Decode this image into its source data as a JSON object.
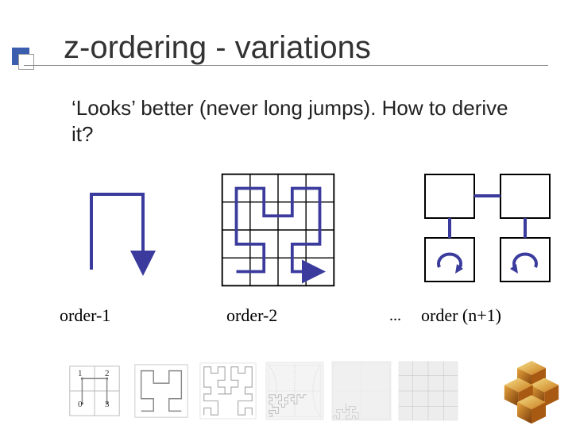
{
  "title": "z-ordering - variations",
  "body": "‘Looks’ better (never long jumps). How to derive it?",
  "figures": {
    "order1_label": "order-1",
    "order2_label": "order-2",
    "ellipsis": "...",
    "ordern_label": "order (n+1)"
  },
  "mini_labels": {
    "tl": "1",
    "tr": "2",
    "bl": "0",
    "br": "3"
  },
  "colors": {
    "curve": "#3b3b9e",
    "grid": "#000000",
    "accent": "#3b5fae"
  }
}
